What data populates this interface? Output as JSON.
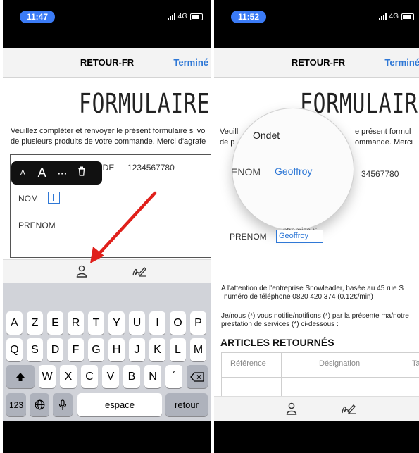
{
  "left_screen": {
    "status": {
      "time": "11:47",
      "network": "4G"
    },
    "nav": {
      "title": "RETOUR-FR",
      "done": "Terminé"
    },
    "document": {
      "heading": "FORMULAIRE DE",
      "intro_line1": "Veuillez compléter et renvoyer le présent formulaire si vo",
      "intro_line2": "de plusieurs produits de votre commande. Merci d'agrafe",
      "order_label_partial": "NDE",
      "order_number": "1234567780",
      "nom_label": "NOM",
      "prenom_label": "PRENOM"
    },
    "edit_popup": {
      "small_a": "A",
      "large_a": "A",
      "more": "···",
      "delete_icon": "trash-icon"
    },
    "toolbar": {
      "person_icon": "person-icon",
      "signature_icon": "signature-icon"
    },
    "keyboard": {
      "row1": [
        "A",
        "Z",
        "E",
        "R",
        "T",
        "Y",
        "U",
        "I",
        "O",
        "P"
      ],
      "row2": [
        "Q",
        "S",
        "D",
        "F",
        "G",
        "H",
        "J",
        "K",
        "L",
        "M"
      ],
      "row3": [
        "W",
        "X",
        "C",
        "V",
        "B",
        "N",
        "´"
      ],
      "shift_icon": "shift-icon",
      "backspace_icon": "backspace-icon",
      "numbers": "123",
      "globe_icon": "globe-icon",
      "mic_icon": "microphone-icon",
      "space": "espace",
      "return": "retour"
    }
  },
  "right_screen": {
    "status": {
      "time": "11:52",
      "network": "4G"
    },
    "nav": {
      "title": "RETOUR-FR",
      "done": "Terminé"
    },
    "document": {
      "heading": "FORMULAIRE",
      "intro_line1_left": "Veuill",
      "intro_line1_right": "e présent formul",
      "intro_line2_left": "de p",
      "intro_line2_right": "ommande. Merci",
      "order_number_partial": "34567780",
      "nom_label_partial": "NO",
      "prenom_label": "PRENOM",
      "prenom_value": "Geoffroy",
      "prenom_value_behind": "ntreprise S",
      "attention_line1": "A l'attention de l'entreprise Snowleader, basée au 45 rue S",
      "attention_line2": "numéro de téléphone 0820 420 374  (0.12€/min)",
      "notify_line1": "Je/nous (*) vous notifie/notifions (*) par la présente ma/notre",
      "notify_line2": "prestation de services (*) ci-dessous :",
      "section_title": "ARTICLES RETOURNÉS",
      "table_headers": [
        "Référence",
        "Désignation",
        "Ta"
      ]
    },
    "magnifier": {
      "suggestion": "Ondet",
      "label": "ENOM",
      "value": "Geoffroy",
      "nom_partial": "NO",
      "prenom_label": "PRENOM",
      "prenom_value": "Geoffroy",
      "behind_text": "ntreprise S"
    },
    "toolbar": {
      "person_icon": "person-icon",
      "signature_icon": "signature-icon"
    }
  },
  "colors": {
    "accent": "#2f78d6",
    "annotation_arrow": "#e0201b",
    "status_pill": "#3b7bf6"
  }
}
